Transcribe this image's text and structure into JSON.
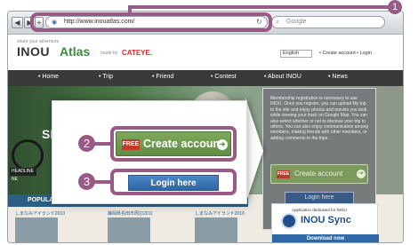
{
  "browser": {
    "url": "http://www.inouatlas.com/",
    "search_placeholder": "Google",
    "back_icon": "back-arrow-icon",
    "forward_icon": "forward-arrow-icon",
    "add_icon": "plus-icon"
  },
  "site": {
    "tagline": "share your adventure",
    "logo_primary": "INOU",
    "logo_secondary": "Atlas",
    "sponsor_label": "made by",
    "sponsor_brand": "CATEYE.",
    "language": "English",
    "header_links": [
      "• Create account",
      "• Login"
    ],
    "nav": [
      "Home",
      "Trip",
      "Friend",
      "Contest",
      "About INOU",
      "News"
    ],
    "hero_text": "SN",
    "headline_label": "HEADLINE NE",
    "signup_text": "Membership registration is necessary to use INOU. Once you register, you can upload My trip to the site and enjoy photos and movies you took while viewing your track on Google Map. You can also select whether or not to disclose your trip to others. You can also enjoy communication among members, making friends with other members, or adding comments to the trips.",
    "mini_free": "FREE",
    "mini_create": "Create account",
    "mini_login": "Login here",
    "popular": "POPULA",
    "feed_items": [
      "しまなみアイランド2010",
      "静岡県島田市周辺2011",
      "しまなみアイランド2010"
    ],
    "sync_subtitle": "Application dedicated for INOU",
    "sync_name": "INOU Sync",
    "sync_download": "Download now"
  },
  "callout": {
    "free_badge": "FREE",
    "create_account": "Create account",
    "login_here": "Login here"
  },
  "steps": [
    "1",
    "2",
    "3"
  ],
  "colors": {
    "accent": "#9a5a86",
    "create_green": "#628c45",
    "login_blue": "#2e66a4",
    "free_red": "#c0392b"
  }
}
